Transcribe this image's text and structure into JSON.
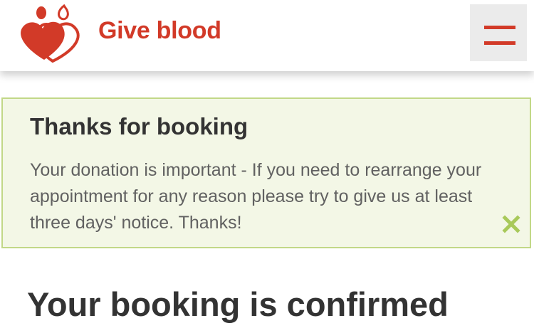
{
  "header": {
    "logo_text": "Give blood",
    "menu_icon": "hamburger-menu-icon",
    "brand_color": "#d23a28"
  },
  "notice": {
    "title": "Thanks for booking",
    "body": "Your donation is important - If you need to rearrange your appointment for any reason please try to give us at least three days' notice. Thanks!",
    "close_icon": "close-icon",
    "background_color": "#f3f7e6",
    "border_color": "#c2d887",
    "close_color": "#a8c95a"
  },
  "main": {
    "title": "Your booking is confirmed"
  }
}
